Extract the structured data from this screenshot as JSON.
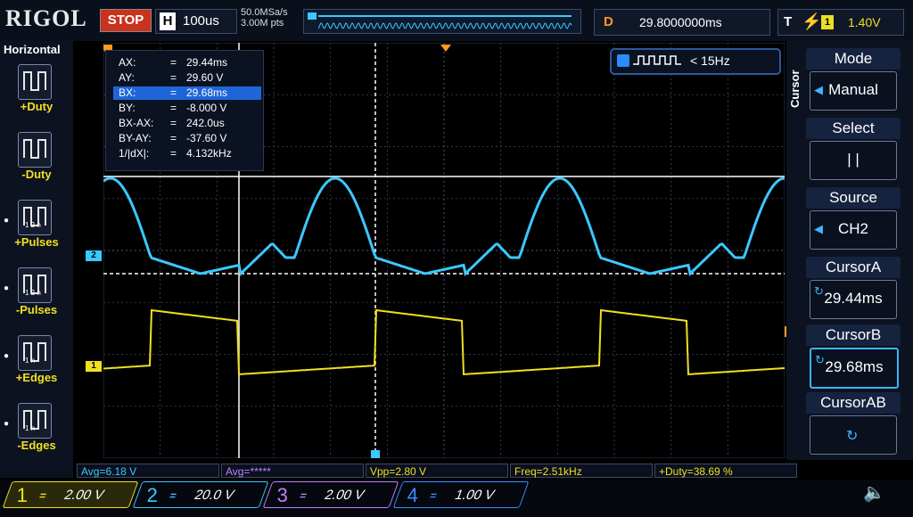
{
  "brand": "RIGOL",
  "run_state": "STOP",
  "horizontal": {
    "label": "H",
    "timebase": "100us"
  },
  "sample": {
    "rate": "50.0MSa/s",
    "points": "3.00M pts"
  },
  "delay": {
    "label": "D",
    "value": "29.8000000ms"
  },
  "trigger": {
    "label": "T",
    "edge_icon": "rising-edge-icon",
    "source": "1",
    "level": "1.40V"
  },
  "left_menu": {
    "title": "Horizontal",
    "items": [
      {
        "label": "+Duty",
        "icon": "pos-duty-icon"
      },
      {
        "label": "-Duty",
        "icon": "neg-duty-icon"
      },
      {
        "label": "+Pulses",
        "icon": "pos-pulses-icon",
        "sub": "1 2 n"
      },
      {
        "label": "-Pulses",
        "icon": "neg-pulses-icon",
        "sub": "1 2 n"
      },
      {
        "label": "+Edges",
        "icon": "pos-edges-icon",
        "sub": "1 n"
      },
      {
        "label": "-Edges",
        "icon": "neg-edges-icon",
        "sub": "1 n"
      }
    ]
  },
  "cursor_readout": [
    {
      "key": "AX:",
      "value": "29.44ms"
    },
    {
      "key": "AY:",
      "value": "29.60 V"
    },
    {
      "key": "BX:",
      "value": "29.68ms",
      "selected": true
    },
    {
      "key": "BY:",
      "value": "-8.000 V"
    },
    {
      "key": "BX-AX:",
      "value": "242.0us"
    },
    {
      "key": "BY-AY:",
      "value": "-37.60 V"
    },
    {
      "key": "1/|dX|:",
      "value": "4.132kHz"
    }
  ],
  "cursor_eq": "=",
  "freq_counter": "< 15Hz",
  "right_menu": {
    "side_label": "Cursor",
    "items": [
      {
        "title": "Mode",
        "value": "Manual",
        "arrow": true
      },
      {
        "title": "Select",
        "value": "|    |"
      },
      {
        "title": "Source",
        "value": "CH2",
        "arrow": true
      },
      {
        "title": "CursorA",
        "value": "29.44ms",
        "knob": true
      },
      {
        "title": "CursorB",
        "value": "29.68ms",
        "knob": true,
        "active": true
      },
      {
        "title": "CursorAB",
        "value": "",
        "knob": true
      }
    ]
  },
  "measurements": [
    {
      "text": "Avg=6.18 V",
      "color": "#3cc8ff"
    },
    {
      "text": "Avg=*****",
      "color": "#c080ff"
    },
    {
      "text": "Vpp=2.80 V",
      "color": "#f0e020"
    },
    {
      "text": "Freq=2.51kHz",
      "color": "#f0e020"
    },
    {
      "text": "+Duty=38.69 %",
      "color": "#f0e020"
    }
  ],
  "channels": [
    {
      "num": "1",
      "coupling": "=",
      "scale": "2.00 V",
      "color": "#f0e020",
      "active": true
    },
    {
      "num": "2",
      "coupling": "=",
      "scale": "20.0 V",
      "color": "#3cc8ff"
    },
    {
      "num": "3",
      "coupling": "=",
      "scale": "2.00 V",
      "color": "#c080ff"
    },
    {
      "num": "4",
      "coupling": "=",
      "scale": "1.00 V",
      "color": "#3c8cff"
    }
  ],
  "markers": {
    "ch1": "1",
    "ch2": "2",
    "trig_h": "T"
  },
  "colors": {
    "ch1": "#f0e020",
    "ch2": "#3cc8ff",
    "trigger": "#ff9a1e",
    "grid": "#3a4a66"
  }
}
